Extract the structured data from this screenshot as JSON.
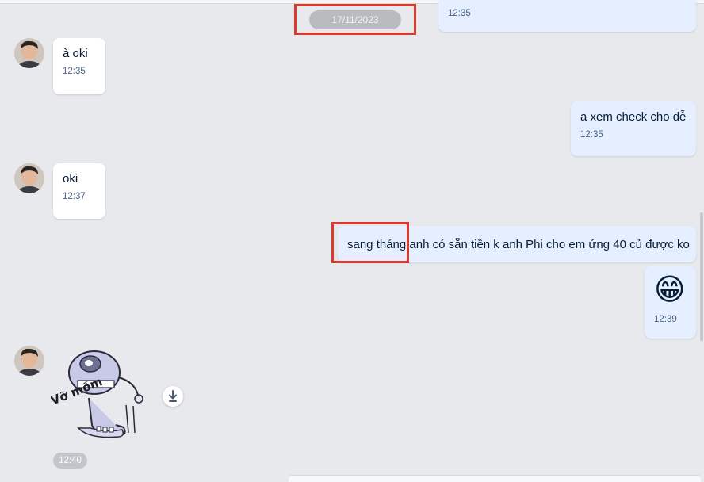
{
  "date_separator": "17/11/2023",
  "colors": {
    "background": "#e8e9ed",
    "incoming_bubble": "#ffffff",
    "outgoing_bubble": "#e5efff",
    "highlight_box": "#d93a2b"
  },
  "messages": [
    {
      "direction": "outgoing",
      "text": "",
      "time": "12:35"
    },
    {
      "direction": "incoming",
      "text": "à oki",
      "time": "12:35"
    },
    {
      "direction": "outgoing",
      "text": "a xem check cho dễ",
      "time": "12:35"
    },
    {
      "direction": "incoming",
      "text": "oki",
      "time": "12:37"
    },
    {
      "direction": "outgoing",
      "text": "sang tháng anh có sẵn tiền k anh Phi cho em ứng 40 củ được ko",
      "time": ""
    },
    {
      "direction": "outgoing",
      "text": "😁",
      "time": "12:39"
    },
    {
      "direction": "incoming",
      "sticker_caption": "Vỡ mồm",
      "time": "12:40"
    }
  ],
  "icons": {
    "download": "download-icon",
    "avatar": "avatar",
    "sticker": "sticker"
  }
}
